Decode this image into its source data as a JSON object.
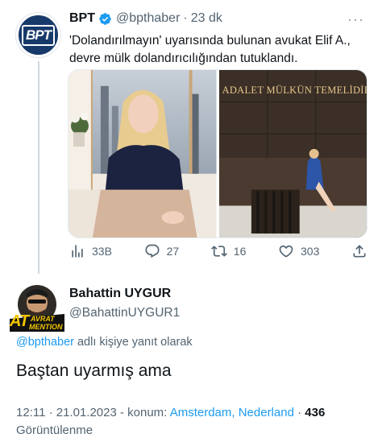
{
  "quoted_tweet": {
    "avatar_text": "BPT",
    "name": "BPT",
    "handle": "@bpthaber",
    "dot": "·",
    "time": "23 dk",
    "more": "···",
    "text": "'Dolandırılmayın' uyarısında bulunan avukat Elif A., devre mülk dolandırıcılığından tutuklandı.",
    "image2_sign": "ADALET MÜLKÜN TEMELİDİR.",
    "actions": {
      "views": "33B",
      "replies": "27",
      "retweets": "16",
      "likes": "303"
    }
  },
  "reply": {
    "avatar_caption_top": "AVRAT",
    "avatar_caption_bottom": "MENTION",
    "avatar_at": "AT",
    "name": "Bahattin UYGUR",
    "handle": "@BahattinUYGUR1",
    "mention": "@bpthaber",
    "replying_suffix": " adlı kişiye yanıt olarak",
    "text": "Baştan uyarmış ama",
    "meta_prefix": "12:11 · 21.01.2023 - konum: ",
    "location": "Amsterdam, Nederland",
    "meta_sep": " · ",
    "views_count": "436",
    "views_label": " Görüntülenme"
  },
  "colors": {
    "accent": "#1d9bf0",
    "secondary_text": "#536471",
    "primary_text": "#0f1419",
    "avatar_bg": "#173a6b"
  }
}
